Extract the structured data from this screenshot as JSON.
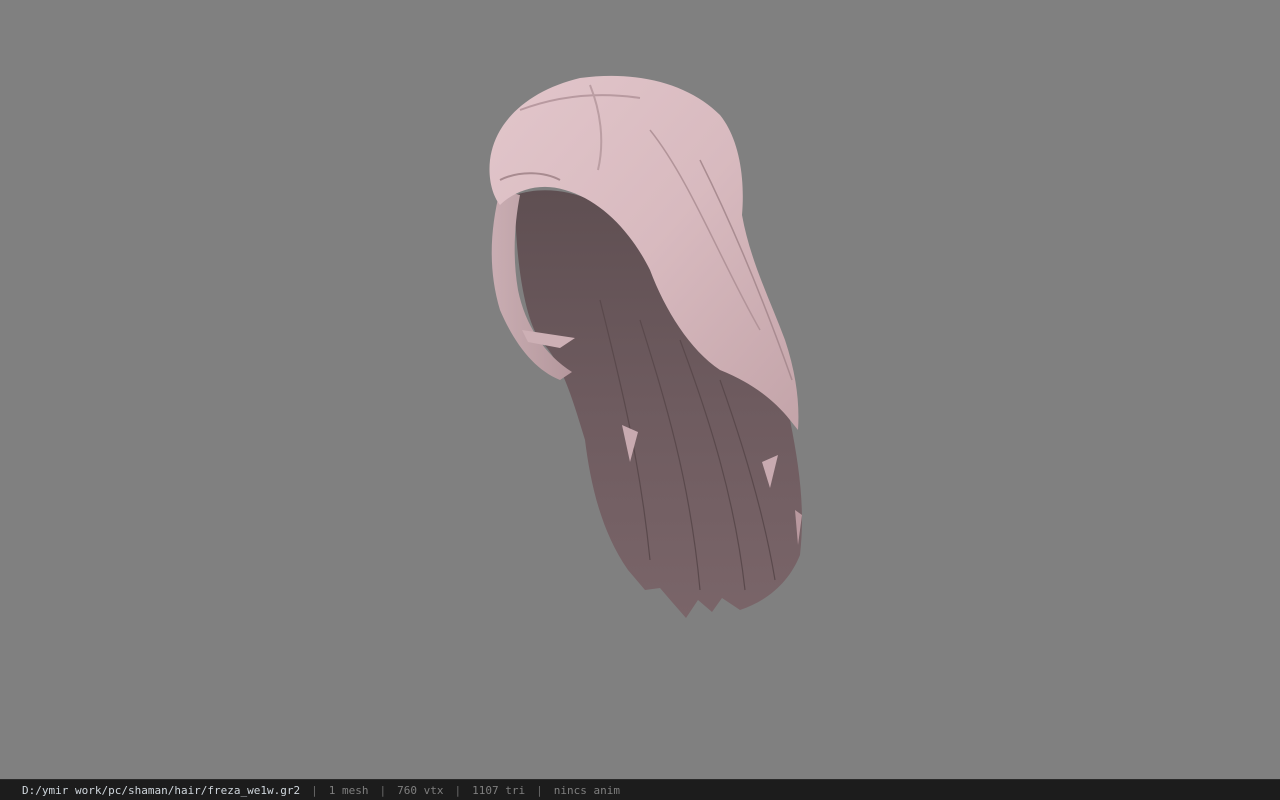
{
  "status_bar": {
    "file_path": "D:/ymir work/pc/shaman/hair/freza_we1w.gr2",
    "separator": "|",
    "mesh_count": "1 mesh",
    "vertex_count": "760 vtx",
    "triangle_count": "1107 tri",
    "animation": "nincs anim"
  },
  "viewport": {
    "background_color": "#808080",
    "model_color": "#d4b7bc",
    "model_shadow_color": "#6e5b5f"
  }
}
